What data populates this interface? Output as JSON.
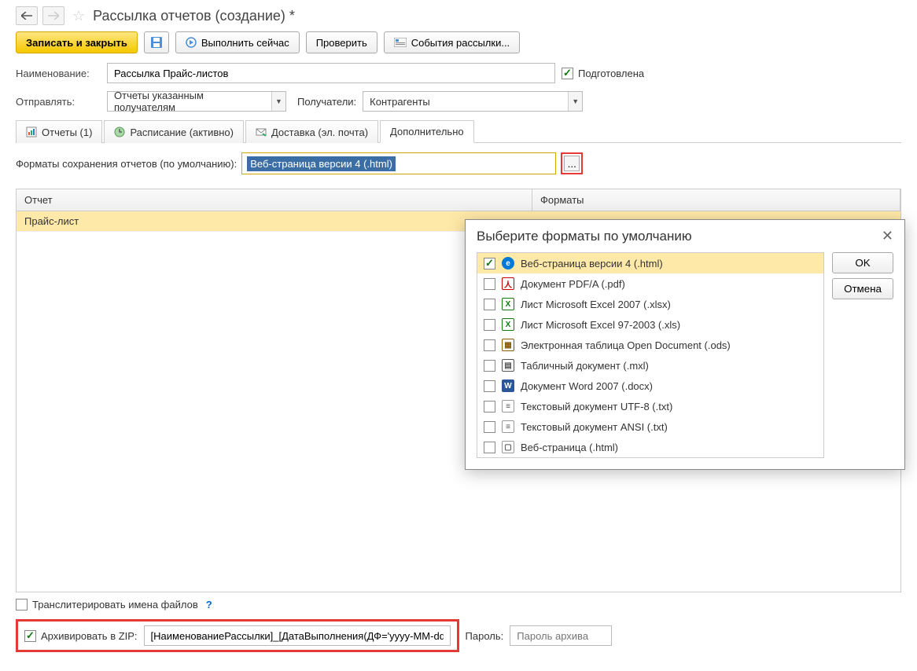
{
  "header": {
    "title": "Рассылка отчетов (создание) *"
  },
  "toolbar": {
    "save_close": "Записать и закрыть",
    "run_now": "Выполнить сейчас",
    "check": "Проверить",
    "events": "События рассылки..."
  },
  "form": {
    "name_label": "Наименование:",
    "name_value": "Рассылка Прайс-листов",
    "prepared_label": "Подготовлена",
    "send_label": "Отправлять:",
    "send_value": "Отчеты указанным получателям",
    "recipients_label": "Получатели:",
    "recipients_value": "Контрагенты"
  },
  "tabs": {
    "reports": "Отчеты (1)",
    "schedule": "Расписание (активно)",
    "delivery": "Доставка (эл. почта)",
    "additional": "Дополнительно"
  },
  "additional": {
    "formats_label": "Форматы сохранения отчетов (по умолчанию):",
    "formats_value": "Веб-страница версии 4 (.html)",
    "ellipsis": "..."
  },
  "table": {
    "col_report": "Отчет",
    "col_formats": "Форматы",
    "row1_report": "Прайс-лист"
  },
  "dialog": {
    "title": "Выберите форматы по умолчанию",
    "ok": "OK",
    "cancel": "Отмена",
    "items": [
      {
        "checked": true,
        "label": "Веб-страница версии 4 (.html)",
        "icon": "edge"
      },
      {
        "checked": false,
        "label": "Документ PDF/A (.pdf)",
        "icon": "pdf"
      },
      {
        "checked": false,
        "label": "Лист Microsoft Excel 2007 (.xlsx)",
        "icon": "xls"
      },
      {
        "checked": false,
        "label": "Лист Microsoft Excel 97-2003 (.xls)",
        "icon": "xls"
      },
      {
        "checked": false,
        "label": "Электронная таблица Open Document (.ods)",
        "icon": "ods"
      },
      {
        "checked": false,
        "label": "Табличный документ (.mxl)",
        "icon": "mxl"
      },
      {
        "checked": false,
        "label": "Документ Word 2007 (.docx)",
        "icon": "doc"
      },
      {
        "checked": false,
        "label": "Текстовый документ UTF-8 (.txt)",
        "icon": "txt"
      },
      {
        "checked": false,
        "label": "Текстовый документ ANSI (.txt)",
        "icon": "txt"
      },
      {
        "checked": false,
        "label": "Веб-страница (.html)",
        "icon": "html"
      }
    ]
  },
  "bottom": {
    "transliterate": "Транслитерировать имена файлов",
    "zip_label": "Архивировать в ZIP:",
    "zip_value": "[НаименованиеРассылки]_[ДатаВыполнения(ДФ='yyyy-MM-dd')]",
    "password_label": "Пароль:",
    "password_placeholder": "Пароль архива"
  }
}
